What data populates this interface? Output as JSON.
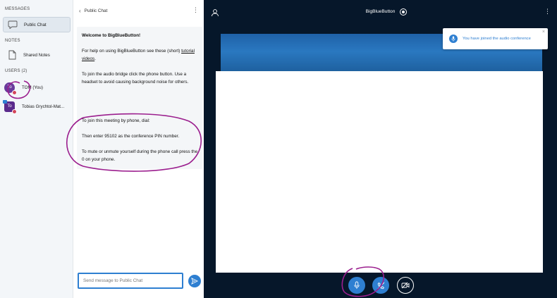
{
  "sidebar": {
    "messages_title": "MESSAGES",
    "public_chat_label": "Public Chat",
    "notes_title": "NOTES",
    "shared_notes_label": "Shared Notes",
    "users_title": "USERS (2)",
    "users": [
      {
        "name": "TOM (You)",
        "initials": "To",
        "shape": "circle"
      },
      {
        "name": "Tobias Grychtol-Mat...",
        "initials": "To",
        "shape": "square"
      }
    ]
  },
  "chat": {
    "title": "Public Chat",
    "welcome_title": "Welcome to BigBlueButton!",
    "help_prefix": "For help on using BigBlueButton see these (short) ",
    "help_link": "tutorial videos",
    "help_suffix": ".",
    "audio_bridge": "To join the audio bridge click the phone button. Use a headset to avoid causing background noise for others.",
    "phone_join": "To join this meeting by phone, dial:",
    "phone_pin": "Then enter 95102 as the conference PIN number.",
    "phone_mute": "To mute or unmute yourself during the phone call press the 0 on your phone.",
    "input_placeholder": "Send message to Public Chat"
  },
  "stage": {
    "title": "BigBlueButton",
    "toast_text": "You have joined the audio conference",
    "toast_close": "×"
  },
  "colors": {
    "accent": "#2e7fd1",
    "stage_bg": "#06172a",
    "annotation": "#9b1e8e",
    "notification_badge": "#d3455b"
  },
  "icons": [
    "chat-icon",
    "notes-icon",
    "back-chevron-icon",
    "kebab-icon",
    "send-icon",
    "users-toggle-icon",
    "record-icon",
    "audio-icon",
    "microphone-icon",
    "hangup-icon",
    "camera-icon",
    "close-icon"
  ]
}
